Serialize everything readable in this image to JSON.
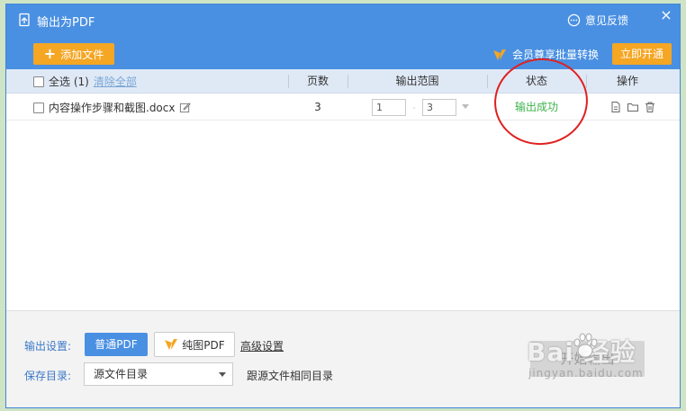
{
  "titlebar": {
    "title": "输出为PDF",
    "feedback_label": "意见反馈",
    "close_symbol": "×"
  },
  "toolbar": {
    "add_file_label": "添加文件",
    "vip_promo_text": "会员尊享批量转换",
    "open_now_label": "立即开通"
  },
  "table": {
    "select_all_label": "全选 (1)",
    "clear_all_label": "清除全部",
    "columns": {
      "pages": "页数",
      "range": "输出范围",
      "status": "状态",
      "ops": "操作"
    },
    "rows": [
      {
        "filename": "内容操作步骤和截图.docx",
        "pages": "3",
        "range_from": "1",
        "range_to": "3",
        "range_separator": "-",
        "status": "输出成功"
      }
    ]
  },
  "settings": {
    "output_label": "输出设置:",
    "normal_pdf_label": "普通PDF",
    "image_pdf_label": "纯图PDF",
    "advanced_label": "高级设置",
    "save_dir_label": "保存目录:",
    "save_dir_value": "源文件目录",
    "save_dir_hint": "跟源文件相同目录",
    "start_label": "开始输出"
  },
  "watermark": {
    "brand": "Bai  经验",
    "sub": "jingyan.baidu.com"
  },
  "colors": {
    "titlebar": "#4a90e2",
    "accent_orange": "#f5a623",
    "success_green": "#3cb34a",
    "annotation_red": "#e02020"
  }
}
